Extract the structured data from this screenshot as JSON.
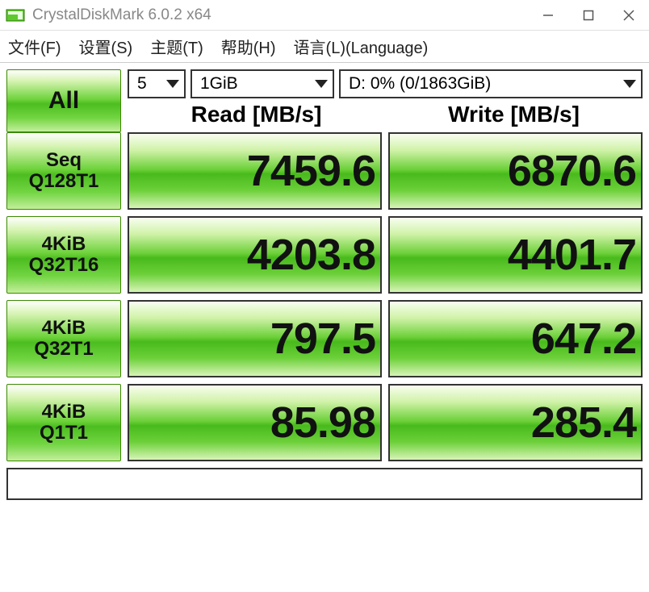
{
  "window": {
    "title": "CrystalDiskMark 6.0.2 x64"
  },
  "menu": {
    "file": "文件(F)",
    "settings": "设置(S)",
    "theme": "主题(T)",
    "help": "帮助(H)",
    "language": "语言(L)(Language)"
  },
  "controls": {
    "all_label": "All",
    "count": "5",
    "size": "1GiB",
    "drive": "D: 0% (0/1863GiB)"
  },
  "headers": {
    "read": "Read [MB/s]",
    "write": "Write [MB/s]"
  },
  "tests": [
    {
      "label_line1": "Seq",
      "label_line2": "Q128T1",
      "read": "7459.6",
      "write": "6870.6",
      "read_pct": 100,
      "write_pct": 100
    },
    {
      "label_line1": "4KiB",
      "label_line2": "Q32T16",
      "read": "4203.8",
      "write": "4401.7",
      "read_pct": 100,
      "write_pct": 100
    },
    {
      "label_line1": "4KiB",
      "label_line2": "Q32T1",
      "read": "797.5",
      "write": "647.2",
      "read_pct": 100,
      "write_pct": 100
    },
    {
      "label_line1": "4KiB",
      "label_line2": "Q1T1",
      "read": "85.98",
      "write": "285.4",
      "read_pct": 100,
      "write_pct": 100
    }
  ],
  "status": ""
}
